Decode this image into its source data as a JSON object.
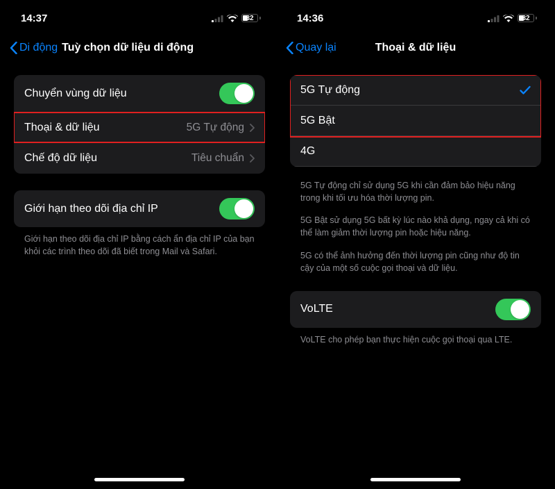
{
  "left": {
    "status": {
      "time": "14:37",
      "battery": "32"
    },
    "nav": {
      "back": "Di động",
      "title": "Tuỳ chọn dữ liệu di động"
    },
    "group1": {
      "roaming": {
        "label": "Chuyển vùng dữ liệu"
      },
      "voicedata": {
        "label": "Thoại & dữ liệu",
        "value": "5G Tự động"
      },
      "datamode": {
        "label": "Chế độ dữ liệu",
        "value": "Tiêu chuẩn"
      }
    },
    "group2": {
      "iplimit": {
        "label": "Giới hạn theo dõi địa chỉ IP"
      }
    },
    "footer1": "Giới hạn theo dõi địa chỉ IP bằng cách ẩn địa chỉ IP của bạn khỏi các trình theo dõi đã biết trong Mail và Safari."
  },
  "right": {
    "status": {
      "time": "14:36",
      "battery": "32"
    },
    "nav": {
      "back": "Quay lại",
      "title": "Thoại & dữ liệu"
    },
    "options": {
      "auto5g": "5G Tự động",
      "on5g": "5G Bật",
      "g4": "4G"
    },
    "info": {
      "p1": "5G Tự động chỉ sử dụng 5G khi cần đảm bảo hiệu năng trong khi tối ưu hóa thời lượng pin.",
      "p2": "5G Bật sử dụng 5G bất kỳ lúc nào khả dụng, ngay cả khi có thể làm giảm thời lượng pin hoặc hiệu năng.",
      "p3": "5G có thể ảnh hưởng đến thời lượng pin cũng như độ tin cậy của một số cuộc gọi thoại và dữ liệu."
    },
    "volte": {
      "label": "VoLTE"
    },
    "volte_footer": "VoLTE cho phép bạn thực hiện cuộc gọi thoại qua LTE."
  }
}
